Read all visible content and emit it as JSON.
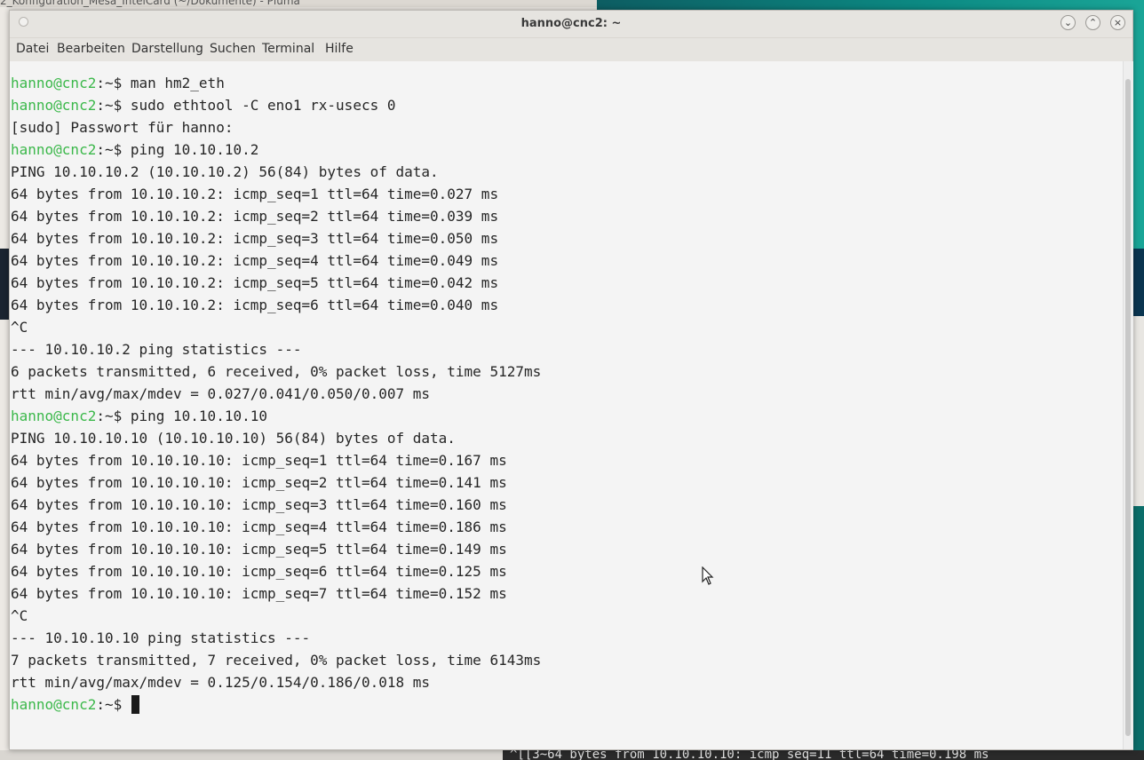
{
  "background": {
    "editor_title": "2_Konfiguration_Mesa_IntelCard (~/Dokumente) - Pluma",
    "bottom_terminal_text": "^[[3~64 bytes from 10.10.10.10: icmp_seq=11 ttl=64 time=0.198 ms"
  },
  "window": {
    "title": "hanno@cnc2: ~",
    "controls": {
      "minimize": "⌄",
      "maximize": "⌃",
      "close": "×"
    }
  },
  "menu": {
    "items": [
      "Datei",
      "Bearbeiten",
      "Darstellung",
      "Suchen",
      "Terminal",
      "Hilfe"
    ]
  },
  "terminal": {
    "prompt_user": "hanno@cnc2",
    "prompt_rest": ":~$ ",
    "lines": [
      {
        "type": "prompt",
        "cmd": "man hm2_eth"
      },
      {
        "type": "prompt",
        "cmd": "sudo ethtool -C eno1 rx-usecs 0"
      },
      {
        "type": "out",
        "text": "[sudo] Passwort für hanno:"
      },
      {
        "type": "prompt",
        "cmd": "ping 10.10.10.2"
      },
      {
        "type": "out",
        "text": "PING 10.10.10.2 (10.10.10.2) 56(84) bytes of data."
      },
      {
        "type": "out",
        "text": "64 bytes from 10.10.10.2: icmp_seq=1 ttl=64 time=0.027 ms"
      },
      {
        "type": "out",
        "text": "64 bytes from 10.10.10.2: icmp_seq=2 ttl=64 time=0.039 ms"
      },
      {
        "type": "out",
        "text": "64 bytes from 10.10.10.2: icmp_seq=3 ttl=64 time=0.050 ms"
      },
      {
        "type": "out",
        "text": "64 bytes from 10.10.10.2: icmp_seq=4 ttl=64 time=0.049 ms"
      },
      {
        "type": "out",
        "text": "64 bytes from 10.10.10.2: icmp_seq=5 ttl=64 time=0.042 ms"
      },
      {
        "type": "out",
        "text": "64 bytes from 10.10.10.2: icmp_seq=6 ttl=64 time=0.040 ms"
      },
      {
        "type": "out",
        "text": "^C"
      },
      {
        "type": "out",
        "text": "--- 10.10.10.2 ping statistics ---"
      },
      {
        "type": "out",
        "text": "6 packets transmitted, 6 received, 0% packet loss, time 5127ms"
      },
      {
        "type": "out",
        "text": "rtt min/avg/max/mdev = 0.027/0.041/0.050/0.007 ms"
      },
      {
        "type": "prompt",
        "cmd": "ping 10.10.10.10"
      },
      {
        "type": "out",
        "text": "PING 10.10.10.10 (10.10.10.10) 56(84) bytes of data."
      },
      {
        "type": "out",
        "text": "64 bytes from 10.10.10.10: icmp_seq=1 ttl=64 time=0.167 ms"
      },
      {
        "type": "out",
        "text": "64 bytes from 10.10.10.10: icmp_seq=2 ttl=64 time=0.141 ms"
      },
      {
        "type": "out",
        "text": "64 bytes from 10.10.10.10: icmp_seq=3 ttl=64 time=0.160 ms"
      },
      {
        "type": "out",
        "text": "64 bytes from 10.10.10.10: icmp_seq=4 ttl=64 time=0.186 ms"
      },
      {
        "type": "out",
        "text": "64 bytes from 10.10.10.10: icmp_seq=5 ttl=64 time=0.149 ms"
      },
      {
        "type": "out",
        "text": "64 bytes from 10.10.10.10: icmp_seq=6 ttl=64 time=0.125 ms"
      },
      {
        "type": "out",
        "text": "64 bytes from 10.10.10.10: icmp_seq=7 ttl=64 time=0.152 ms"
      },
      {
        "type": "out",
        "text": "^C"
      },
      {
        "type": "out",
        "text": "--- 10.10.10.10 ping statistics ---"
      },
      {
        "type": "out",
        "text": "7 packets transmitted, 7 received, 0% packet loss, time 6143ms"
      },
      {
        "type": "out",
        "text": "rtt min/avg/max/mdev = 0.125/0.154/0.186/0.018 ms"
      },
      {
        "type": "prompt",
        "cmd": "",
        "cursor": true
      }
    ]
  },
  "colors": {
    "prompt_green": "#3cb84b",
    "text": "#262626",
    "terminal_bg": "#f4f4f4"
  }
}
